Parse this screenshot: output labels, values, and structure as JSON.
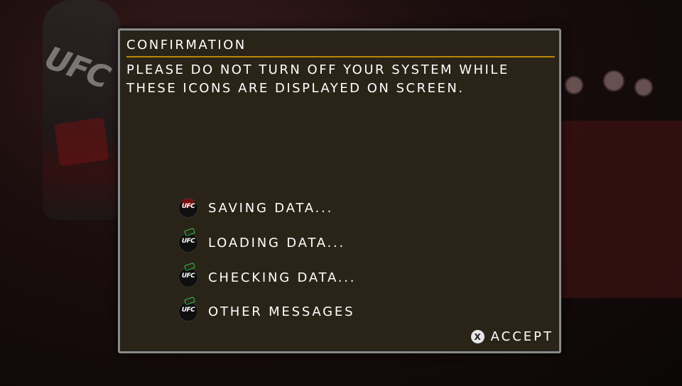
{
  "dialog": {
    "title": "CONFIRMATION",
    "message_line1": "PLEASE DO NOT TURN OFF YOUR SYSTEM WHILE",
    "message_line2": "THESE ICONS ARE DISPLAYED ON SCREEN.",
    "icon_badge_text": "UFC",
    "icons": [
      {
        "label": "SAVING DATA...",
        "icon": "ufc-saving-icon"
      },
      {
        "label": "LOADING DATA...",
        "icon": "ufc-loading-icon"
      },
      {
        "label": "CHECKING DATA...",
        "icon": "ufc-checking-icon"
      },
      {
        "label": "OTHER MESSAGES",
        "icon": "ufc-other-icon"
      }
    ],
    "accept_button_glyph": "X",
    "accept_label": "ACCEPT"
  },
  "background": {
    "glove_text": "UFC"
  },
  "colors": {
    "dialog_bg": "#2a2418",
    "title_rule": "#b8860b",
    "border": "#8a8a8a",
    "progress_arrow": "#35c24a",
    "saving_accent": "#7a1010"
  }
}
